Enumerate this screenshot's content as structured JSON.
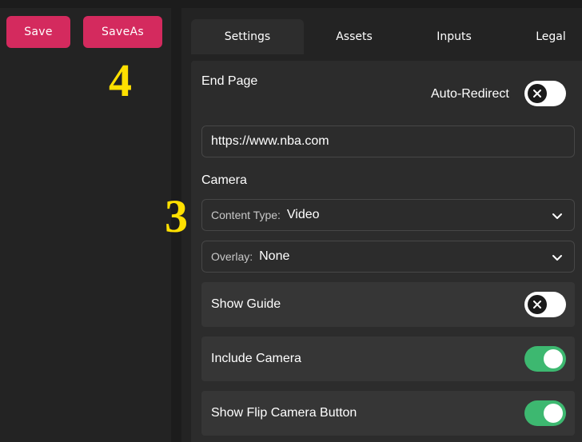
{
  "toolbar": {
    "save_label": "Save",
    "saveas_label": "SaveAs"
  },
  "annotations": {
    "four": "4",
    "three": "3"
  },
  "tabs": [
    {
      "label": "Settings",
      "active": true
    },
    {
      "label": "Assets",
      "active": false
    },
    {
      "label": "Inputs",
      "active": false
    },
    {
      "label": "Legal",
      "active": false
    }
  ],
  "end_page": {
    "heading": "End Page",
    "auto_redirect_label": "Auto-Redirect",
    "auto_redirect_on": false,
    "url_value": "https://www.nba.com"
  },
  "camera": {
    "heading": "Camera",
    "content_type": {
      "label": "Content Type:",
      "value": "Video"
    },
    "overlay": {
      "label": "Overlay:",
      "value": "None"
    },
    "toggles": [
      {
        "label": "Show Guide",
        "on": false
      },
      {
        "label": "Include Camera",
        "on": true
      },
      {
        "label": "Show Flip Camera Button",
        "on": true
      }
    ]
  },
  "colors": {
    "accent": "#d42a5e",
    "toggle_on": "#3db870",
    "annotation": "#ffe000"
  }
}
